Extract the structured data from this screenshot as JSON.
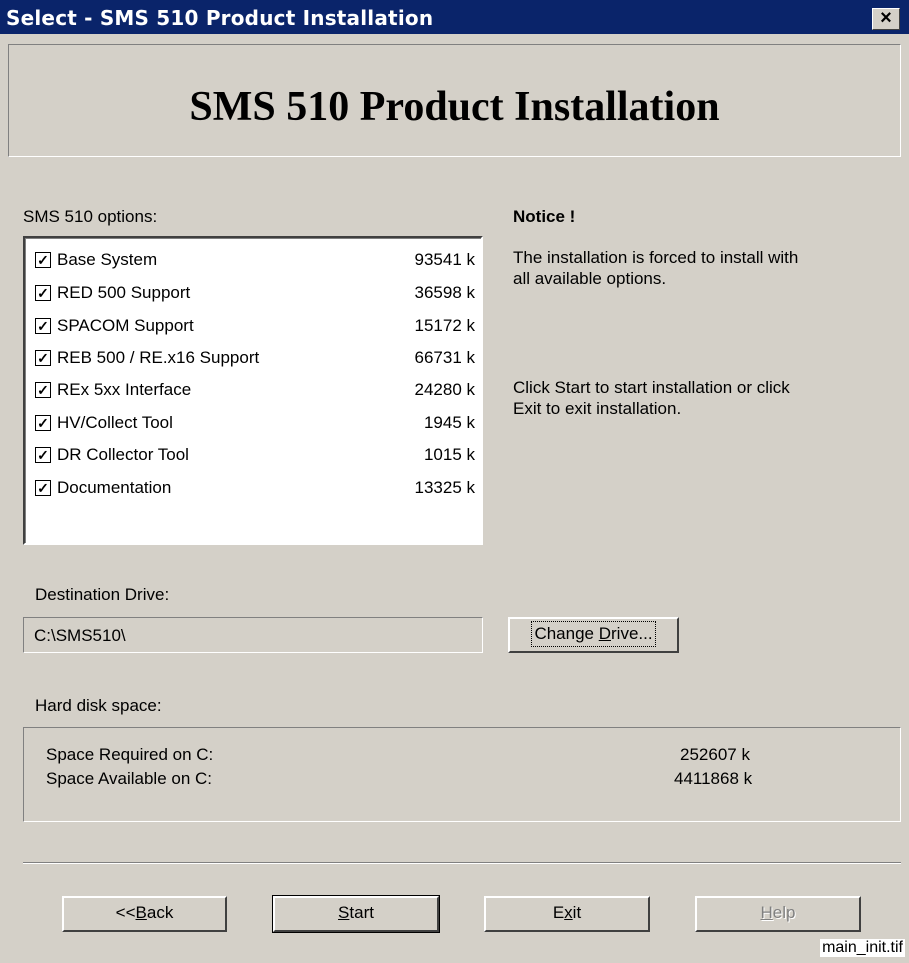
{
  "window": {
    "title": "Select - SMS 510 Product Installation",
    "close_label": "×"
  },
  "banner": {
    "title": "SMS 510 Product Installation"
  },
  "options": {
    "label": "SMS 510 options:",
    "items": [
      {
        "name": "Base System",
        "size": "93541 k",
        "checked": true
      },
      {
        "name": "RED 500 Support",
        "size": "36598 k",
        "checked": true
      },
      {
        "name": "SPACOM Support",
        "size": "15172 k",
        "checked": true
      },
      {
        "name": "REB 500 / RE.x16 Support",
        "size": "66731 k",
        "checked": true
      },
      {
        "name": "REx 5xx Interface",
        "size": "24280 k",
        "checked": true
      },
      {
        "name": "HV/Collect Tool",
        "size": "1945 k",
        "checked": true
      },
      {
        "name": "DR Collector Tool",
        "size": "1015 k",
        "checked": true
      },
      {
        "name": "Documentation",
        "size": "13325 k",
        "checked": true
      }
    ]
  },
  "notice": {
    "title": "Notice !",
    "line1": "The installation is forced to install with",
    "line2": "all available options.",
    "line3": "Click Start to start installation or click",
    "line4": "Exit to exit installation."
  },
  "destination": {
    "label": "Destination Drive:",
    "value": "C:\\SMS510\\",
    "change_button": {
      "prefix": "Change ",
      "accel": "D",
      "suffix": "rive..."
    }
  },
  "disk": {
    "label": "Hard disk space:",
    "required_label": "Space Required on C:",
    "required_value": "252607 k",
    "available_label": "Space Available on C:",
    "available_value": "4411868 k"
  },
  "buttons": {
    "back": {
      "prefix": "<<",
      "accel": "B",
      "suffix": "ack"
    },
    "start": {
      "prefix": "",
      "accel": "S",
      "suffix": "tart"
    },
    "exit": {
      "prefix": "E",
      "accel": "x",
      "suffix": "it"
    },
    "help": {
      "prefix": "",
      "accel": "H",
      "suffix": "elp",
      "enabled": false
    }
  },
  "caption": "main_init.tif"
}
